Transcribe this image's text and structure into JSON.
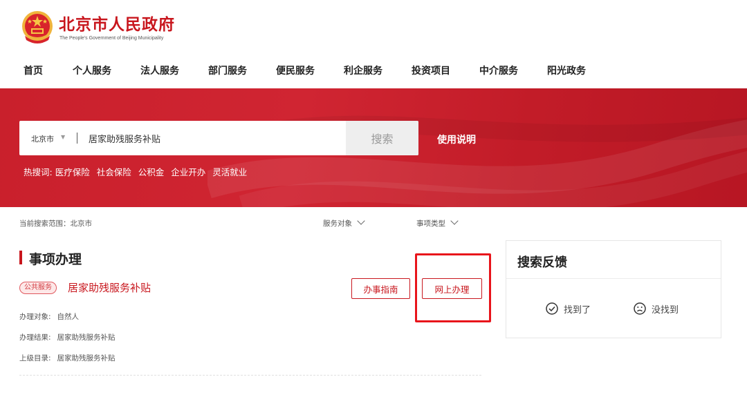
{
  "site": {
    "title": "北京市人民政府",
    "subtitle": "The People's Government of Beijing Municipality"
  },
  "nav": [
    {
      "label": "首页"
    },
    {
      "label": "个人服务"
    },
    {
      "label": "法人服务"
    },
    {
      "label": "部门服务"
    },
    {
      "label": "便民服务"
    },
    {
      "label": "利企服务"
    },
    {
      "label": "投资项目"
    },
    {
      "label": "中介服务"
    },
    {
      "label": "阳光政务"
    }
  ],
  "search": {
    "region": "北京市",
    "value": "居家助残服务补贴",
    "button": "搜索",
    "usage_link": "使用说明",
    "hot_label": "热搜词:",
    "hot_words": [
      "医疗保险",
      "社会保险",
      "公积金",
      "企业开办",
      "灵活就业"
    ]
  },
  "filters": {
    "scope": "当前搜索范围：北京市",
    "service_target": "服务对象",
    "item_type": "事项类型"
  },
  "section": {
    "title": "事项办理"
  },
  "item": {
    "tag": "公共服务",
    "title": "居家助残服务补贴",
    "guide_button": "办事指南",
    "online_button": "网上办理",
    "details": [
      {
        "label": "办理对象:",
        "value": "自然人"
      },
      {
        "label": "办理结果:",
        "value": "居家助残服务补贴"
      },
      {
        "label": "上级目录:",
        "value": "居家助残服务补贴"
      }
    ]
  },
  "feedback": {
    "title": "搜索反馈",
    "found": "找到了",
    "not_found": "没找到"
  },
  "colors": {
    "brand_red": "#c8161d",
    "highlight": "#e8141b"
  }
}
